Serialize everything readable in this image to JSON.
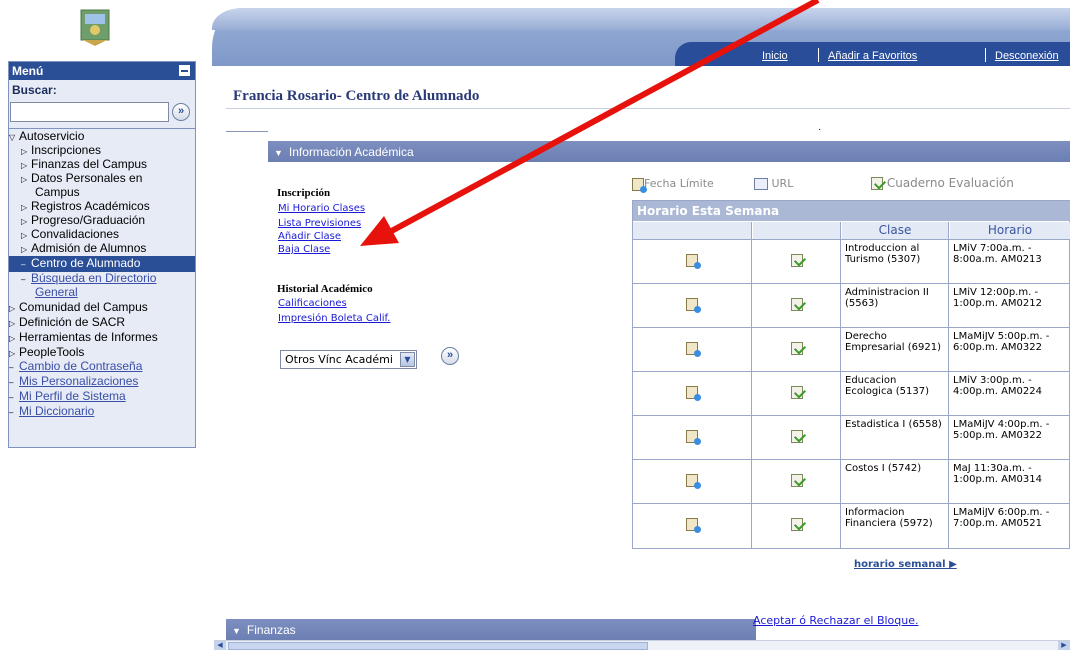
{
  "header": {
    "nav": [
      "Inicio",
      "Añadir a Favoritos",
      "Desconexión"
    ]
  },
  "menu": {
    "title": "Menú",
    "search_label": "Buscar:",
    "search_value": "",
    "go_glyph": "»",
    "items": [
      {
        "label": "Autoservicio",
        "icon": "triangle-down-icon"
      },
      {
        "label": "Inscripciones",
        "icon": "triangle-right-icon"
      },
      {
        "label": "Finanzas del Campus",
        "icon": "triangle-right-icon"
      },
      {
        "label": "Datos Personales en",
        "icon": "triangle-right-icon"
      },
      {
        "label": "Campus"
      },
      {
        "label": "Registros Académicos",
        "icon": "triangle-right-icon"
      },
      {
        "label": "Progreso/Graduación",
        "icon": "triangle-right-icon"
      },
      {
        "label": "Convalidaciones",
        "icon": "triangle-right-icon"
      },
      {
        "label": "Admisión de Alumnos",
        "icon": "triangle-right-icon"
      },
      {
        "label": "Centro de Alumnado",
        "selected": true
      },
      {
        "label": "Búsqueda en Directorio"
      },
      {
        "label": "General"
      },
      {
        "label": "Comunidad del Campus",
        "icon": "triangle-right-icon"
      },
      {
        "label": "Definición de SACR",
        "icon": "triangle-right-icon"
      },
      {
        "label": "Herramientas de Informes",
        "icon": "triangle-right-icon"
      },
      {
        "label": "PeopleTools",
        "icon": "triangle-right-icon"
      },
      {
        "label": "Cambio de Contraseña"
      },
      {
        "label": "Mis Personalizaciones"
      },
      {
        "label": "Mi Perfil de Sistema"
      },
      {
        "label": "Mi Diccionario"
      }
    ]
  },
  "main": {
    "title": "Francia Rosario- Centro de Alumnado",
    "academic_section": "Información Académica",
    "enrollment_heading": "Inscripción",
    "enrollment_links": [
      "Mi Horario Clases",
      "Lista Previsiones",
      "Añadir Clase",
      "Baja Clase"
    ],
    "history_heading": "Historial Académico",
    "history_links": [
      "Calificaciones",
      "Impresión Boleta Calif."
    ],
    "other_links_select": "Otros Vínc Académi",
    "legend": {
      "deadline": "Fecha Límite",
      "url": "URL",
      "gradebook": "Cuaderno Evaluación"
    },
    "schedule": {
      "title": "Horario Esta Semana",
      "col_class": "Clase",
      "col_time": "Horario",
      "rows": [
        {
          "class": "Introduccion al Turismo (5307)",
          "time": "LMiV 7:00a.m. - 8:00a.m. AM0213"
        },
        {
          "class": "Administracion II (5563)",
          "time": "LMiV 12:00p.m. - 1:00p.m. AM0212"
        },
        {
          "class": "Derecho Empresarial (6921)",
          "time": "LMaMiJV 5:00p.m. - 6:00p.m. AM0322"
        },
        {
          "class": "Educacion Ecologica (5137)",
          "time": "LMiV 3:00p.m. - 4:00p.m. AM0224"
        },
        {
          "class": "Estadistica I (6558)",
          "time": "LMaMiJV 4:00p.m. - 5:00p.m. AM0322"
        },
        {
          "class": "Costos I (5742)",
          "time": "MaJ 11:30a.m. - 1:00p.m. AM0314"
        },
        {
          "class": "Informacion Financiera (5972)",
          "time": "LMaMiJV 6:00p.m. - 7:00p.m. AM0521"
        }
      ],
      "weekly_link": "horario semanal"
    },
    "accept_link": "Aceptar ó Rechazar el Bloque.",
    "finance_section": "Finanzas"
  },
  "colors": {
    "brand": "#2b4f97",
    "section": "#7385bb",
    "annotation_arrow": "#e8120c"
  }
}
